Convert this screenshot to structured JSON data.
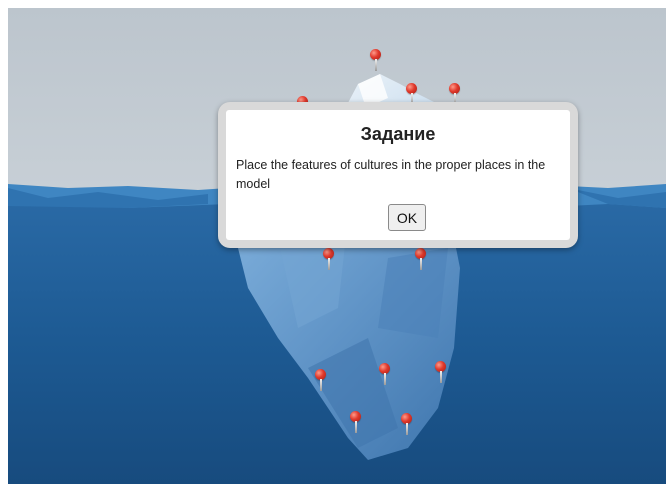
{
  "dialog": {
    "title": "Задание",
    "message": "Place the features of cultures in the proper places in the model",
    "ok_label": "OK"
  },
  "scene": {
    "sky_color": "#c3cbd3",
    "water_color": "#1d5a93",
    "ice_color": "#5f93c6",
    "pin_color": "#e0392c",
    "pin_count": 12
  }
}
